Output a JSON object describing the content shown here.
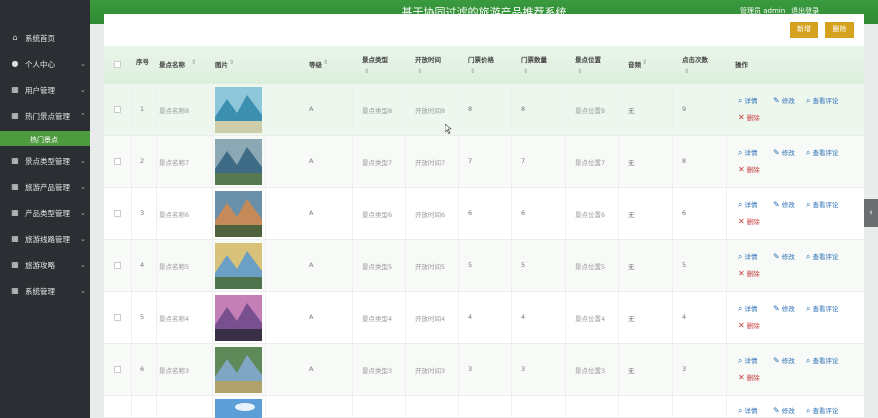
{
  "header": {
    "title": "基于协同过滤的旅游产品推荐系统",
    "user_label": "管理员 admin",
    "logout": "退出登录"
  },
  "sidebar": {
    "items": [
      {
        "label": "系统首页",
        "icon": "home-icon"
      },
      {
        "label": "个人中心",
        "icon": "user-icon"
      },
      {
        "label": "用户管理",
        "icon": "grid-icon"
      },
      {
        "label": "热门景点管理",
        "icon": "grid-icon"
      },
      {
        "label": "景点类型管理",
        "icon": "grid-icon"
      },
      {
        "label": "旅游产品管理",
        "icon": "grid-icon"
      },
      {
        "label": "产品类型管理",
        "icon": "grid-icon"
      },
      {
        "label": "旅游线路管理",
        "icon": "grid-icon"
      },
      {
        "label": "旅游攻略",
        "icon": "grid-icon"
      },
      {
        "label": "系统管理",
        "icon": "grid-icon"
      }
    ],
    "active_sub": "热门景点"
  },
  "toolbar": {
    "add_label": "新增",
    "delete_label": "删除"
  },
  "table": {
    "columns": [
      "序号",
      "景点名称",
      "图片",
      "等级",
      "景点类型",
      "开放时间",
      "门票价格",
      "门票数量",
      "景点位置",
      "音频",
      "点击次数",
      "操作"
    ],
    "rows": [
      {
        "no": "1",
        "name": "景点名称8",
        "level": "A",
        "type": "景点类型8",
        "time": "开放时间8",
        "price": "8",
        "qty": "8",
        "loc": "景点位置8",
        "audio": "无",
        "clicks": "9"
      },
      {
        "no": "2",
        "name": "景点名称7",
        "level": "A",
        "type": "景点类型7",
        "time": "开放时间7",
        "price": "7",
        "qty": "7",
        "loc": "景点位置7",
        "audio": "无",
        "clicks": "8"
      },
      {
        "no": "3",
        "name": "景点名称6",
        "level": "A",
        "type": "景点类型6",
        "time": "开放时间6",
        "price": "6",
        "qty": "6",
        "loc": "景点位置6",
        "audio": "无",
        "clicks": "6"
      },
      {
        "no": "4",
        "name": "景点名称5",
        "level": "A",
        "type": "景点类型5",
        "time": "开放时间5",
        "price": "5",
        "qty": "5",
        "loc": "景点位置5",
        "audio": "无",
        "clicks": "5"
      },
      {
        "no": "5",
        "name": "景点名称4",
        "level": "A",
        "type": "景点类型4",
        "time": "开放时间4",
        "price": "4",
        "qty": "4",
        "loc": "景点位置4",
        "audio": "无",
        "clicks": "4"
      },
      {
        "no": "6",
        "name": "景点名称3",
        "level": "A",
        "type": "景点类型3",
        "time": "开放时间3",
        "price": "3",
        "qty": "3",
        "loc": "景点位置3",
        "audio": "无",
        "clicks": "3"
      }
    ],
    "actions": {
      "detail": "详情",
      "edit": "修改",
      "comments": "查看评论",
      "delete": "删除"
    }
  },
  "colors": {
    "header_green": "#2f8a33",
    "sidebar_bg": "#2b2e32",
    "active_green": "#4e9a3f",
    "button_gold": "#d4a21c",
    "link_blue": "#2a6fb5",
    "delete_red": "#c53a3a"
  }
}
